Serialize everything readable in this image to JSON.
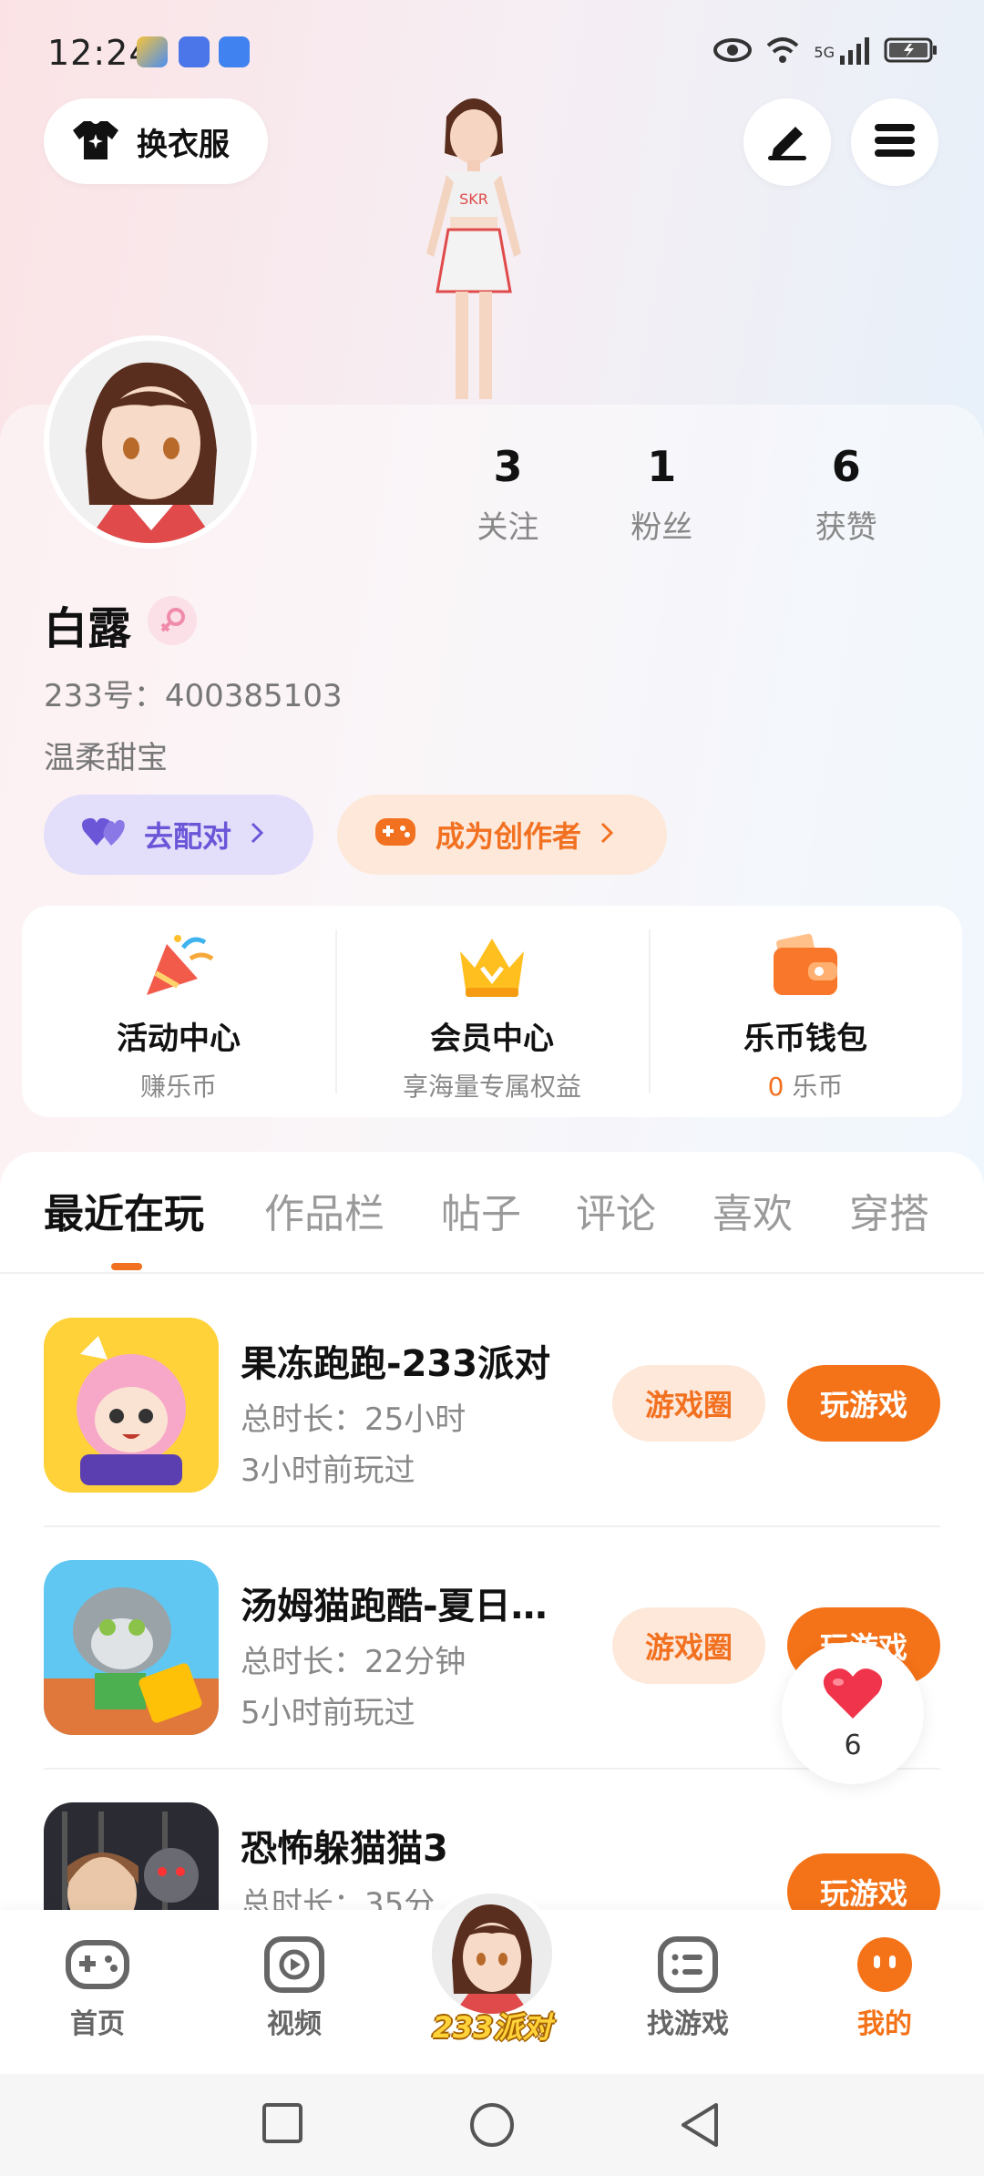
{
  "status_bar": {
    "time": "12:24",
    "network": "5G"
  },
  "top_bar": {
    "outfit_label": "换衣服"
  },
  "profile": {
    "name": "白露",
    "uid": "233号：400385103",
    "bio": "温柔甜宝",
    "stats": [
      {
        "value": "3",
        "label": "关注"
      },
      {
        "value": "1",
        "label": "粉丝"
      },
      {
        "value": "6",
        "label": "获赞"
      }
    ],
    "match_label": "去配对",
    "creator_label": "成为创作者"
  },
  "quick_entries": [
    {
      "title": "活动中心",
      "sub": "赚乐币"
    },
    {
      "title": "会员中心",
      "sub": "享海量专属权益"
    },
    {
      "title": "乐币钱包",
      "sub_value": "0",
      "sub_unit": "乐币"
    }
  ],
  "tabs": [
    "最近在玩",
    "作品栏",
    "帖子",
    "评论",
    "喜欢",
    "穿搭"
  ],
  "games": [
    {
      "name": "果冻跑跑-233派对",
      "duration": "总时长：25小时",
      "last_played": "3小时前玩过",
      "circle_label": "游戏圈",
      "play_label": "玩游戏"
    },
    {
      "name": "汤姆猫跑酷-夏日…",
      "duration": "总时长：22分钟",
      "last_played": "5小时前玩过",
      "circle_label": "游戏圈",
      "play_label": "玩游戏"
    },
    {
      "name": "恐怖躲猫猫3",
      "duration": "总时长：35分",
      "play_label": "玩游戏"
    }
  ],
  "like_float": {
    "count": "6"
  },
  "bottom_nav": {
    "items": [
      "首页",
      "视频",
      "找游戏",
      "我的"
    ],
    "center_badge": "233派对"
  },
  "colors": {
    "accent": "#f47218",
    "match": "#6b56d8",
    "heart": "#f0344b"
  }
}
